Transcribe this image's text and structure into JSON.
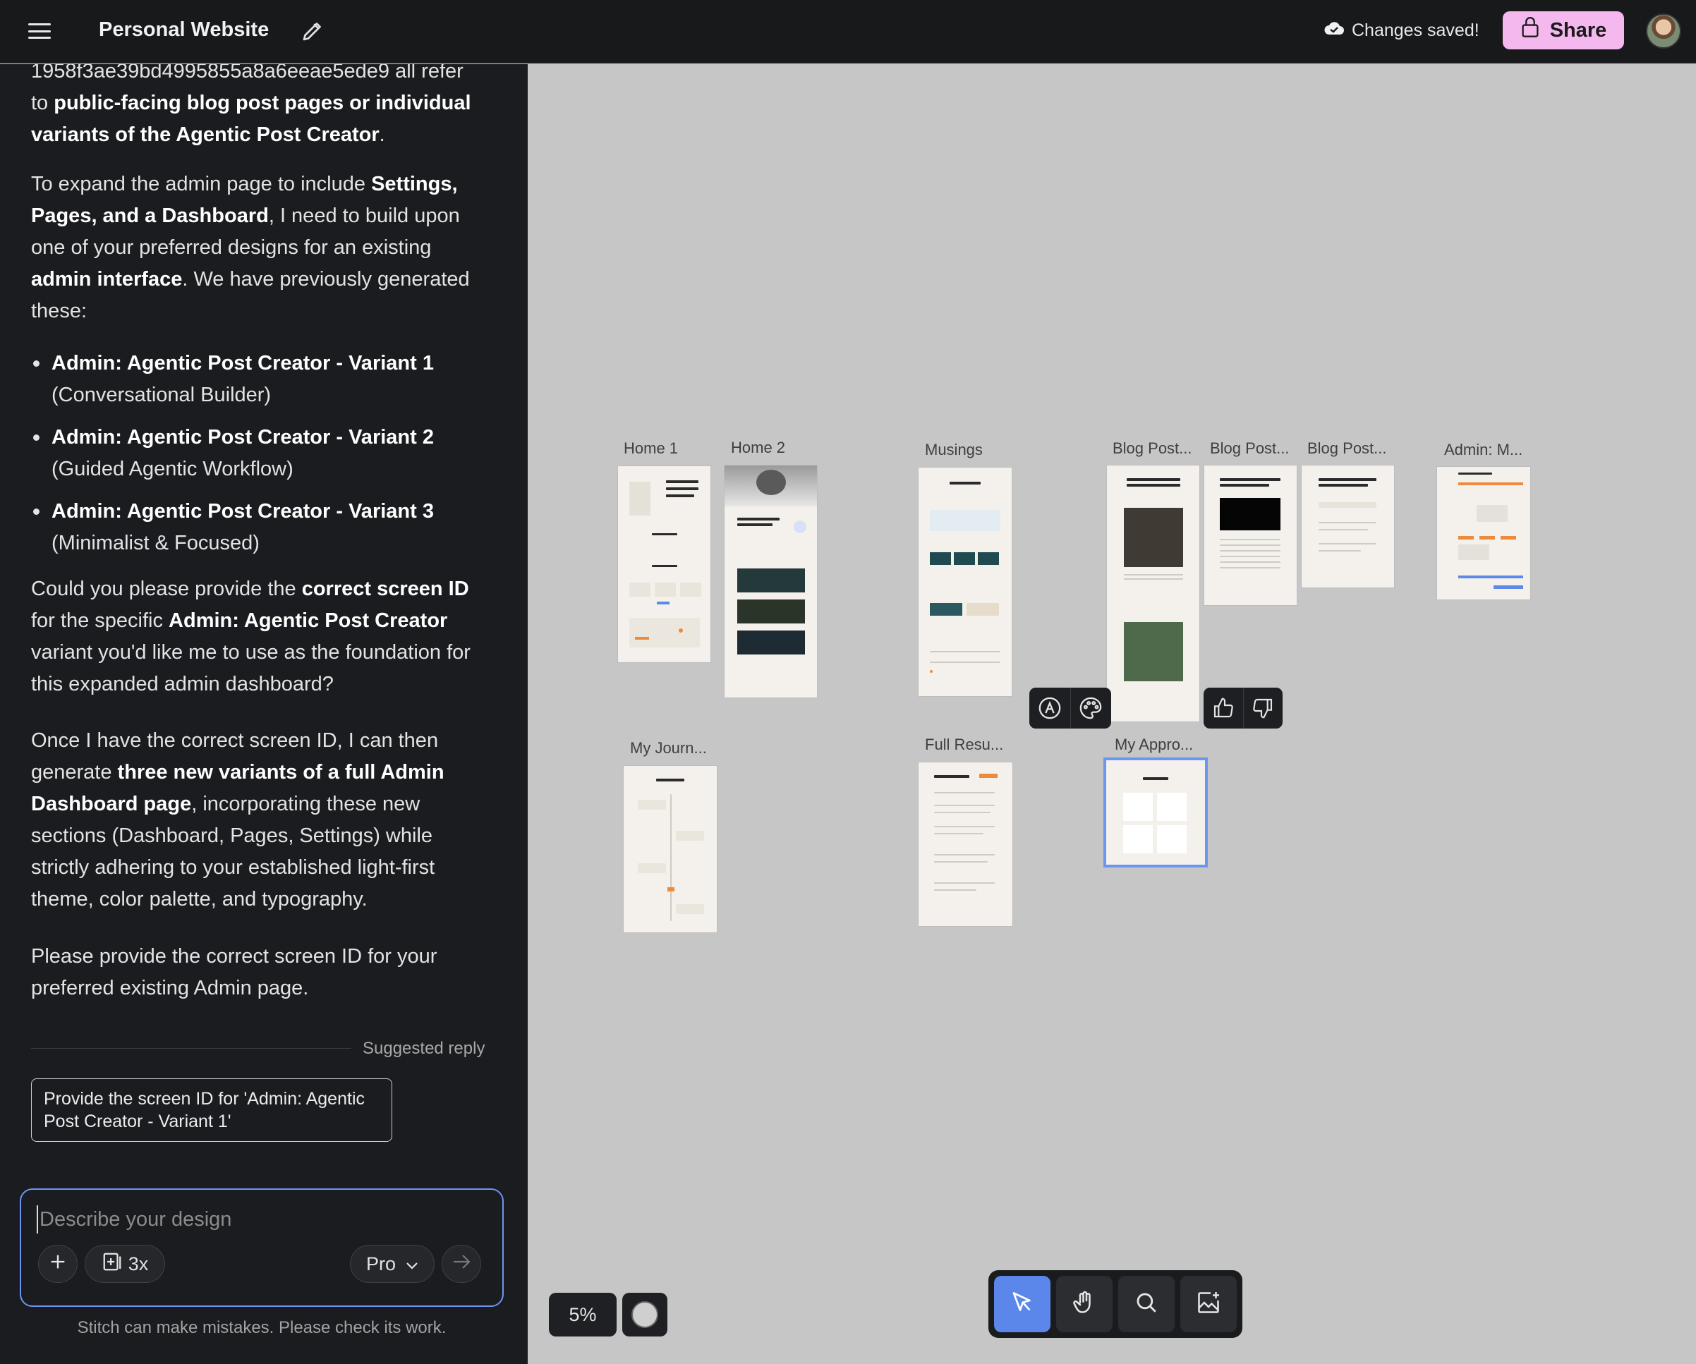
{
  "header": {
    "project_title": "Personal Website",
    "saved_status": "Changes saved!",
    "share_label": "Share"
  },
  "chat": {
    "partial_line_1": "1958f3ae39bd4995855a8a6eeae5ede9 all refer",
    "partial_line_2_a": "to ",
    "partial_line_2_b": "public-facing blog post pages or individual variants of the Agentic Post Creator",
    "partial_line_2_c": ".",
    "para2_a": "To expand the admin page to include ",
    "para2_b": "Settings, Pages, and a Dashboard",
    "para2_c": ", I need to build upon one of your preferred designs for an existing ",
    "para2_d": "admin interface",
    "para2_e": ". We have previously generated these:",
    "variants": [
      {
        "title": "Admin: Agentic Post Creator - Variant 1",
        "desc": "(Conversational Builder)"
      },
      {
        "title": "Admin: Agentic Post Creator - Variant 2",
        "desc": "(Guided Agentic Workflow)"
      },
      {
        "title": "Admin: Agentic Post Creator - Variant 3",
        "desc": "(Minimalist & Focused)"
      }
    ],
    "para3_a": "Could you please provide the ",
    "para3_b": "correct screen ID",
    "para3_c": " for the specific ",
    "para3_d": "Admin: Agentic Post Creator",
    "para3_e": " variant you'd like me to use as the foundation for this expanded admin dashboard?",
    "para4_a": "Once I have the correct screen ID, I can then generate ",
    "para4_b": "three new variants of a full Admin Dashboard page",
    "para4_c": ", incorporating these new sections (Dashboard, Pages, Settings) while strictly adhering to your established light-first theme, color palette, and typography.",
    "para5": "Please provide the correct screen ID for your preferred existing Admin page.",
    "suggested_label": "Suggested reply",
    "suggested_reply": "Provide the screen ID for 'Admin: Agentic Post Creator - Variant 1'"
  },
  "composer": {
    "placeholder": "Describe your design",
    "multiplier": "3x",
    "model": "Pro",
    "disclaimer": "Stitch can make mistakes. Please check its work."
  },
  "canvas": {
    "zoom": "5%",
    "frames": [
      {
        "label": "Home 1"
      },
      {
        "label": "Home 2"
      },
      {
        "label": "Musings"
      },
      {
        "label": "Blog Post..."
      },
      {
        "label": "Blog Post..."
      },
      {
        "label": "Blog Post..."
      },
      {
        "label": "Admin: M..."
      },
      {
        "label": "My Journ..."
      },
      {
        "label": "Full Resu..."
      },
      {
        "label": "My Appro..."
      }
    ]
  },
  "icons": {
    "menu": "hamburger-icon",
    "edit": "pencil-icon",
    "saved": "cloud-check-icon",
    "share": "lock-icon",
    "add": "plus-icon",
    "multi": "add-frame-icon",
    "send": "arrow-right-icon",
    "select": "cursor-icon",
    "pan": "hand-icon",
    "search": "search-icon",
    "image": "add-image-icon",
    "annotate": "annotate-icon",
    "theme": "palette-icon",
    "like": "thumbs-up-icon",
    "dislike": "thumbs-down-icon"
  },
  "colors": {
    "accent": "#6b96f0",
    "share_bg": "#f4b8ee",
    "panel_bg": "#1b1c1f",
    "canvas_bg": "#c6c6c6"
  }
}
